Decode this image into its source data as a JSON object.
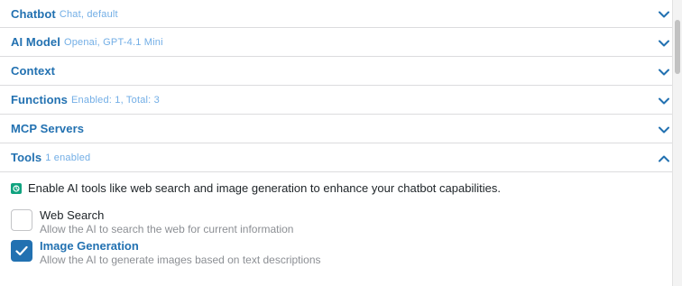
{
  "sections": [
    {
      "title": "Chatbot",
      "meta": "Chat, default",
      "chevron": "chevron-down-icon"
    },
    {
      "title": "AI Model",
      "meta": "Openai, GPT-4.1 Mini",
      "chevron": "chevron-down-icon"
    },
    {
      "title": "Context",
      "meta": "",
      "chevron": "chevron-down-icon"
    },
    {
      "title": "Functions",
      "meta": "Enabled: 1, Total: 3",
      "chevron": "chevron-down-icon"
    },
    {
      "title": "MCP Servers",
      "meta": "",
      "chevron": "chevron-down-icon"
    },
    {
      "title": "Tools",
      "meta": "1 enabled",
      "chevron": "chevron-up-icon"
    }
  ],
  "tools": {
    "intro": "Enable AI tools like web search and image generation to enhance your chatbot capabilities.",
    "items": [
      {
        "name": "Web Search",
        "description": "Allow the AI to search the web for current information",
        "checked": false
      },
      {
        "name": "Image Generation",
        "description": "Allow the AI to generate images based on text descriptions",
        "checked": true
      }
    ]
  },
  "colors": {
    "accent": "#2271b1",
    "meta": "#72aee6",
    "openai_icon": "#10a37f"
  }
}
